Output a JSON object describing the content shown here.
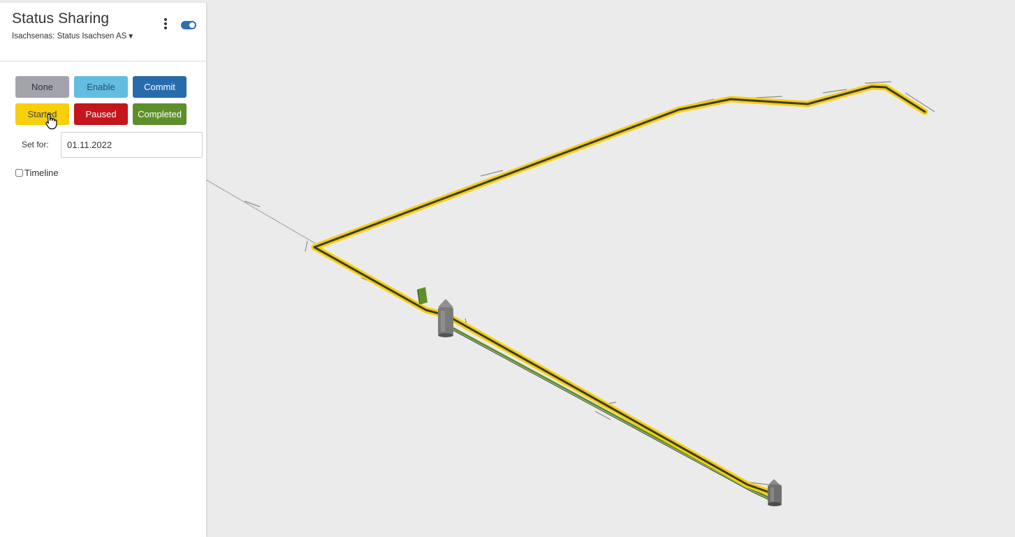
{
  "panel": {
    "title": "Status Sharing",
    "project_label": "Isachsenas: Status Isachsen AS",
    "project_caret": "▼",
    "more_icon": "kebab-vertical-icon",
    "toggle_state": "on"
  },
  "status_buttons": [
    {
      "label": "None",
      "color": "#a3a3ab"
    },
    {
      "label": "Enable",
      "color": "#62bde0"
    },
    {
      "label": "Commit",
      "color": "#286bad"
    },
    {
      "label": "Started",
      "color": "#f7cf0a"
    },
    {
      "label": "Paused",
      "color": "#c4161c"
    },
    {
      "label": "Completed",
      "color": "#5e8f2a"
    }
  ],
  "set_for": {
    "label": "Set for:",
    "value": "01.11.2022"
  },
  "timeline": {
    "label": "Timeline",
    "checked": false
  },
  "viewport": {
    "background": "#ebebeb",
    "highlight_color": "#f7cf0a",
    "pipe_color": "#3a3a3a",
    "completed_color": "#5e8f2a"
  }
}
